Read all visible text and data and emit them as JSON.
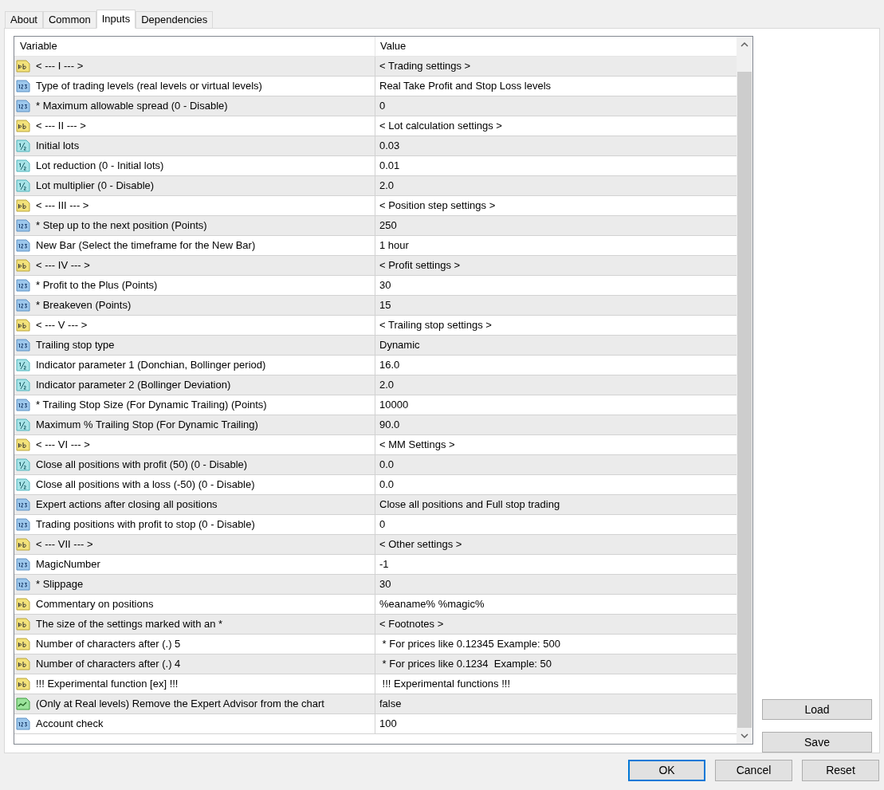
{
  "tabs": [
    {
      "label": "About",
      "selected": false
    },
    {
      "label": "Common",
      "selected": false
    },
    {
      "label": "Inputs",
      "selected": true
    },
    {
      "label": "Dependencies",
      "selected": false
    }
  ],
  "table": {
    "columns": [
      "Variable",
      "Value"
    ],
    "rows": [
      {
        "kind": "string",
        "variable": "< --- I --- >",
        "value": "< Trading settings >"
      },
      {
        "kind": "int",
        "variable": "Type of trading levels (real levels or virtual levels)",
        "value": "Real Take Profit and Stop Loss levels"
      },
      {
        "kind": "int",
        "variable": "* Maximum allowable spread (0 - Disable)",
        "value": "0"
      },
      {
        "kind": "string",
        "variable": "< --- II --- >",
        "value": "< Lot calculation settings >"
      },
      {
        "kind": "double",
        "variable": "Initial lots",
        "value": "0.03"
      },
      {
        "kind": "double",
        "variable": "Lot reduction (0 - Initial lots)",
        "value": "0.01"
      },
      {
        "kind": "double",
        "variable": "Lot multiplier (0 - Disable)",
        "value": "2.0"
      },
      {
        "kind": "string",
        "variable": "< --- III --- >",
        "value": "< Position step settings >"
      },
      {
        "kind": "int",
        "variable": "* Step up to the next position (Points)",
        "value": "250"
      },
      {
        "kind": "int",
        "variable": "New Bar (Select the timeframe for the New Bar)",
        "value": "1 hour"
      },
      {
        "kind": "string",
        "variable": "< --- IV --- >",
        "value": "< Profit settings >"
      },
      {
        "kind": "int",
        "variable": "* Profit to the Plus (Points)",
        "value": "30"
      },
      {
        "kind": "int",
        "variable": "* Breakeven (Points)",
        "value": "15"
      },
      {
        "kind": "string",
        "variable": "< --- V --- >",
        "value": "< Trailing stop settings >"
      },
      {
        "kind": "int",
        "variable": "Trailing stop type",
        "value": "Dynamic"
      },
      {
        "kind": "double",
        "variable": "Indicator parameter 1 (Donchian, Bollinger period)",
        "value": "16.0"
      },
      {
        "kind": "double",
        "variable": "Indicator parameter 2 (Bollinger Deviation)",
        "value": "2.0"
      },
      {
        "kind": "int",
        "variable": "* Trailing Stop Size (For Dynamic Trailing) (Points)",
        "value": "10000"
      },
      {
        "kind": "double",
        "variable": "Maximum % Trailing Stop (For Dynamic Trailing)",
        "value": "90.0"
      },
      {
        "kind": "string",
        "variable": "< --- VI --- >",
        "value": "< MM Settings >"
      },
      {
        "kind": "double",
        "variable": "Close all positions with profit (50) (0 - Disable)",
        "value": "0.0"
      },
      {
        "kind": "double",
        "variable": "Close all positions with a loss (-50) (0 - Disable)",
        "value": "0.0"
      },
      {
        "kind": "int",
        "variable": "Expert actions after closing all positions",
        "value": "Close all positions and Full stop trading"
      },
      {
        "kind": "int",
        "variable": "Trading positions with profit to stop (0 - Disable)",
        "value": "0"
      },
      {
        "kind": "string",
        "variable": "< --- VII --- >",
        "value": "< Other settings >"
      },
      {
        "kind": "int",
        "variable": "MagicNumber",
        "value": "-1"
      },
      {
        "kind": "int",
        "variable": "* Slippage",
        "value": "30"
      },
      {
        "kind": "string",
        "variable": "Commentary on positions",
        "value": "%eaname% %magic%"
      },
      {
        "kind": "string",
        "variable": "The size of the settings marked with an *",
        "value": "< Footnotes >"
      },
      {
        "kind": "string",
        "variable": "Number of characters after (.) 5",
        "value": " * For prices like 0.12345 Example: 500"
      },
      {
        "kind": "string",
        "variable": "Number of characters after (.) 4",
        "value": " * For prices like 0.1234  Example: 50"
      },
      {
        "kind": "string",
        "variable": "!!! Experimental function [ex] !!!",
        "value": " !!! Experimental functions !!!"
      },
      {
        "kind": "bool",
        "variable": "(Only at Real levels) Remove the Expert Advisor from the chart",
        "value": "false"
      },
      {
        "kind": "int",
        "variable": "Account check",
        "value": "100"
      }
    ]
  },
  "side_buttons": [
    "Load",
    "Save"
  ],
  "footer_buttons": [
    {
      "label": "OK",
      "default": true
    },
    {
      "label": "Cancel",
      "default": false
    },
    {
      "label": "Reset",
      "default": false
    }
  ]
}
